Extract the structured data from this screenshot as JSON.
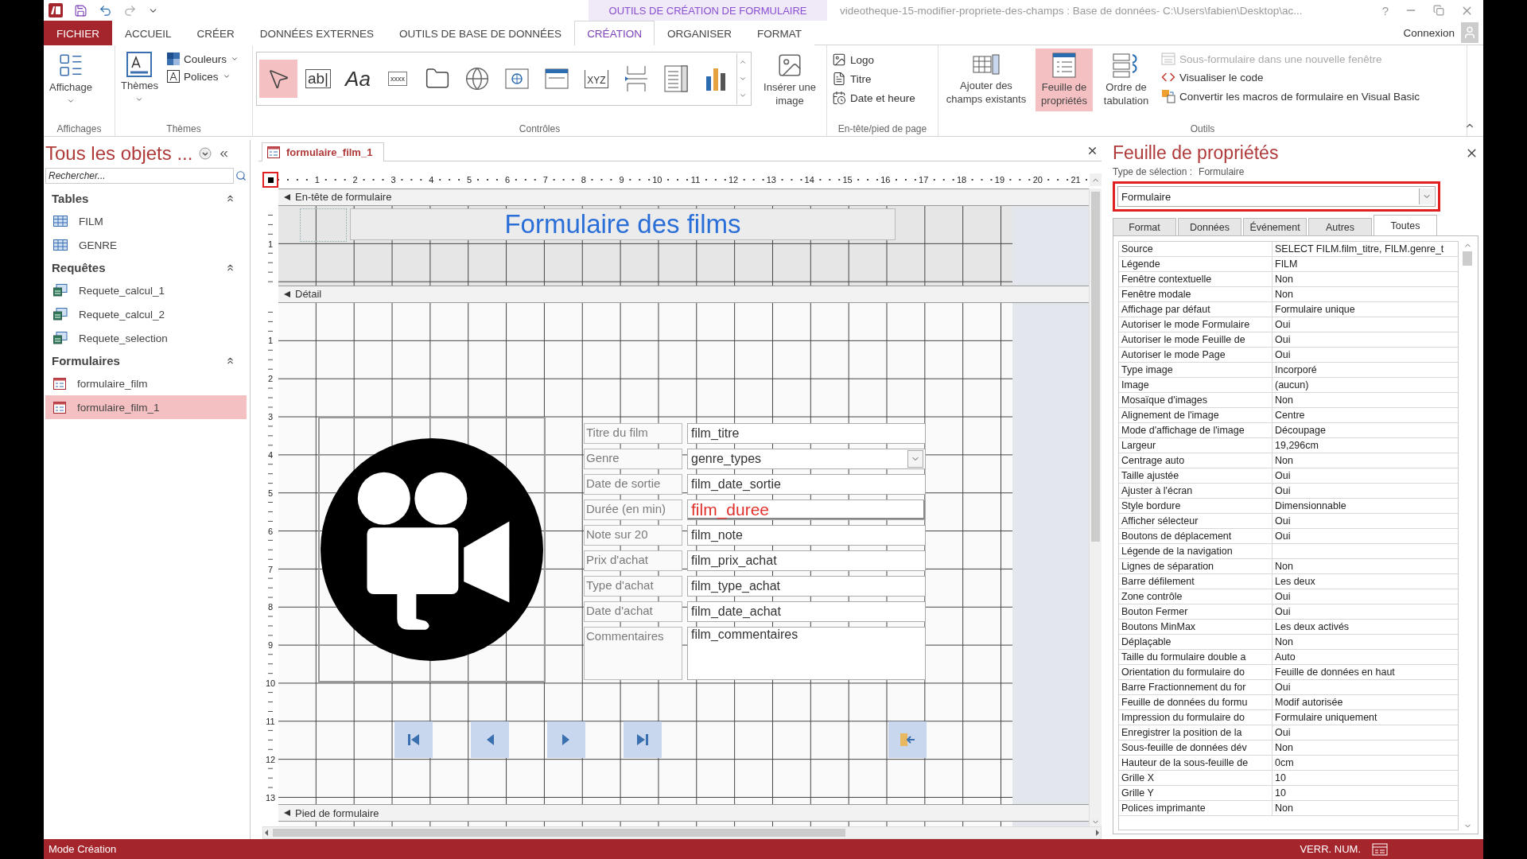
{
  "title_bar": {
    "context": "OUTILS DE CRÉATION DE FORMULAIRE",
    "title": "videotheque-15-modifier-propriete-des-champs : Base de données- C:\\Users\\fabien\\Desktop\\ac...",
    "help": "?"
  },
  "ribbon_tabs": [
    {
      "label": "FICHIER",
      "kind": "file",
      "selected": false
    },
    {
      "label": "ACCUEIL",
      "kind": "tab",
      "selected": false
    },
    {
      "label": "CRÉER",
      "kind": "tab",
      "selected": false
    },
    {
      "label": "DONNÉES EXTERNES",
      "kind": "tab",
      "selected": false
    },
    {
      "label": "OUTILS DE BASE DE DONNÉES",
      "kind": "tab",
      "selected": false
    },
    {
      "label": "CRÉATION",
      "kind": "tab",
      "selected": true
    },
    {
      "label": "ORGANISER",
      "kind": "tab",
      "selected": false
    },
    {
      "label": "FORMAT",
      "kind": "tab",
      "selected": false
    }
  ],
  "account": "Connexion",
  "ribbon": {
    "views": {
      "title": "Affichages",
      "button": "Affichage"
    },
    "themes": {
      "title": "Thèmes",
      "button": "Thèmes",
      "colors": "Couleurs",
      "fonts": "Polices"
    },
    "controls": {
      "title": "Contrôles",
      "insert_image": "Insérer une image",
      "gallery": [
        {
          "kind": "pointer",
          "selected": true
        },
        {
          "kind": "textbox",
          "glyph": "ab|",
          "selected": false
        },
        {
          "kind": "label",
          "glyph": "Aa",
          "selected": false
        },
        {
          "kind": "button",
          "glyph": "xxxx",
          "selected": false
        },
        {
          "kind": "tabs",
          "selected": false
        },
        {
          "kind": "link",
          "selected": false
        },
        {
          "kind": "browser",
          "selected": false
        },
        {
          "kind": "navigation",
          "selected": false
        },
        {
          "kind": "group",
          "glyph": "XYZ",
          "selected": false
        },
        {
          "kind": "pagebreak",
          "selected": false
        },
        {
          "kind": "combo",
          "selected": false
        },
        {
          "kind": "chart",
          "selected": false
        }
      ]
    },
    "header_footer": {
      "title": "En-tête/pied de page",
      "items": [
        {
          "kind": "logo",
          "label": "Logo"
        },
        {
          "kind": "title",
          "label": "Titre"
        },
        {
          "kind": "datetime",
          "label": "Date et heure"
        }
      ]
    },
    "tools": {
      "title": "Outils",
      "large": [
        {
          "kind": "fields",
          "label": "Ajouter des champs existants",
          "selected": false
        },
        {
          "kind": "sheet",
          "label": "Feuille de propriétés",
          "selected": true
        },
        {
          "kind": "taborder",
          "label": "Ordre de tabulation",
          "selected": false
        }
      ],
      "small": [
        {
          "kind": "subform",
          "label": "Sous-formulaire dans une nouvelle fenêtre",
          "disabled": true
        },
        {
          "kind": "code",
          "label": "Visualiser le code",
          "disabled": false
        },
        {
          "kind": "convert",
          "label": "Convertir les macros de formulaire en Visual Basic",
          "disabled": false
        }
      ]
    }
  },
  "nav_pane": {
    "title": "Tous les objets ...",
    "search": {
      "placeholder": "Rechercher..."
    },
    "groups": [
      {
        "title": "Tables",
        "expanded": true,
        "items": [
          {
            "kind": "table",
            "label": "FILM",
            "selected": false
          },
          {
            "kind": "table",
            "label": "GENRE",
            "selected": false
          }
        ]
      },
      {
        "title": "Requêtes",
        "expanded": true,
        "items": [
          {
            "kind": "query",
            "label": "Requete_calcul_1",
            "selected": false
          },
          {
            "kind": "query",
            "label": "Requete_calcul_2",
            "selected": false
          },
          {
            "kind": "query",
            "label": "Requete_selection",
            "selected": false
          }
        ]
      },
      {
        "title": "Formulaires",
        "expanded": true,
        "items": [
          {
            "kind": "form",
            "label": "formulaire_film",
            "selected": false
          },
          {
            "kind": "form",
            "label": "formulaire_film_1",
            "selected": true
          }
        ]
      }
    ]
  },
  "document": {
    "tab": "formulaire_film_1",
    "ruler": [
      "1",
      "2",
      "3",
      "4",
      "5",
      "6",
      "7",
      "8",
      "9",
      "10",
      "11",
      "12",
      "13",
      "14",
      "15",
      "16",
      "17",
      "18",
      "19",
      "20",
      "21"
    ],
    "header_section": {
      "title": "En-tête de formulaire",
      "ruler": [
        "1"
      ],
      "form_title": "Formulaire des films"
    },
    "detail_section": {
      "title": "Détail",
      "ruler": [
        "1",
        "2",
        "3",
        "4",
        "5",
        "6",
        "7",
        "8",
        "9",
        "10",
        "11",
        "12",
        "13"
      ],
      "fields": [
        {
          "label": "Titre du film",
          "value": "film_titre",
          "kind": "text",
          "emphasized": false
        },
        {
          "label": "Genre",
          "value": "genre_types",
          "kind": "combo",
          "emphasized": false
        },
        {
          "label": "Date de sortie",
          "value": "film_date_sortie",
          "kind": "text",
          "emphasized": false
        },
        {
          "label": "Durée (en min)",
          "value": "film_duree",
          "kind": "text",
          "emphasized": true
        },
        {
          "label": "Note sur 20",
          "value": "film_note",
          "kind": "text",
          "emphasized": false
        },
        {
          "label": "Prix d'achat",
          "value": "film_prix_achat",
          "kind": "text",
          "emphasized": false
        },
        {
          "label": "Type d'achat",
          "value": "film_type_achat",
          "kind": "text",
          "emphasized": false
        },
        {
          "label": "Date d'achat",
          "value": "film_date_achat",
          "kind": "text",
          "emphasized": false
        },
        {
          "label": "Commentaires",
          "value": "film_commentaires",
          "kind": "memo",
          "emphasized": false
        }
      ],
      "nav_buttons": [
        {
          "kind": "first"
        },
        {
          "kind": "previous"
        },
        {
          "kind": "next"
        },
        {
          "kind": "last"
        }
      ],
      "exit_button": {
        "kind": "exit"
      }
    },
    "footer_section": {
      "title": "Pied de formulaire"
    }
  },
  "property_sheet": {
    "title": "Feuille de propriétés",
    "selection_type_label": "Type de sélection :",
    "selection_type": "Formulaire",
    "object": "Formulaire",
    "tabs": [
      {
        "label": "Format",
        "selected": false
      },
      {
        "label": "Données",
        "selected": false
      },
      {
        "label": "Événement",
        "selected": false
      },
      {
        "label": "Autres",
        "selected": false
      },
      {
        "label": "Toutes",
        "selected": true
      }
    ],
    "rows": [
      {
        "name": "Source",
        "value": "SELECT FILM.film_titre, FILM.genre_t"
      },
      {
        "name": "Légende",
        "value": "FILM"
      },
      {
        "name": "Fenêtre contextuelle",
        "value": "Non"
      },
      {
        "name": "Fenêtre modale",
        "value": "Non"
      },
      {
        "name": "Affichage par défaut",
        "value": "Formulaire unique"
      },
      {
        "name": "Autoriser le mode Formulaire",
        "value": "Oui"
      },
      {
        "name": "Autoriser le mode Feuille de",
        "value": "Oui"
      },
      {
        "name": "Autoriser le mode Page",
        "value": "Oui"
      },
      {
        "name": "Type image",
        "value": "Incorporé"
      },
      {
        "name": "Image",
        "value": "(aucun)"
      },
      {
        "name": "Mosaïque d'images",
        "value": "Non"
      },
      {
        "name": "Alignement de l'image",
        "value": "Centre"
      },
      {
        "name": "Mode d'affichage de l'image",
        "value": "Découpage"
      },
      {
        "name": "Largeur",
        "value": "19,296cm"
      },
      {
        "name": "Centrage auto",
        "value": "Non"
      },
      {
        "name": "Taille ajustée",
        "value": "Oui"
      },
      {
        "name": "Ajuster à l'écran",
        "value": "Oui"
      },
      {
        "name": "Style bordure",
        "value": "Dimensionnable"
      },
      {
        "name": "Afficher sélecteur",
        "value": "Oui"
      },
      {
        "name": "Boutons de déplacement",
        "value": "Oui"
      },
      {
        "name": "Légende de la navigation"
      },
      {
        "name": "Lignes de séparation",
        "value": "Non"
      },
      {
        "name": "Barre défilement",
        "value": "Les deux"
      },
      {
        "name": "Zone contrôle",
        "value": "Oui"
      },
      {
        "name": "Bouton Fermer",
        "value": "Oui"
      },
      {
        "name": "Boutons MinMax",
        "value": "Les deux activés"
      },
      {
        "name": "Déplaçable",
        "value": "Non"
      },
      {
        "name": "Taille du formulaire double a",
        "value": "Auto"
      },
      {
        "name": "Orientation du formulaire do",
        "value": "Feuille de données en haut"
      },
      {
        "name": "Barre Fractionnement du for",
        "value": "Oui"
      },
      {
        "name": "Feuille de données du formu",
        "value": "Modif autorisée"
      },
      {
        "name": "Impression du formulaire do",
        "value": "Formulaire uniquement"
      },
      {
        "name": "Enregistrer la position de la",
        "value": "Oui"
      },
      {
        "name": "Sous-feuille de données dév",
        "value": "Non"
      },
      {
        "name": "Hauteur de la sous-feuille de",
        "value": "0cm"
      },
      {
        "name": "Grille X",
        "value": "10"
      },
      {
        "name": "Grille Y",
        "value": "10"
      },
      {
        "name": "Polices imprimante",
        "value": "Non"
      }
    ]
  },
  "status_bar": {
    "mode": "Mode Création",
    "indicator": "VERR. NUM."
  }
}
